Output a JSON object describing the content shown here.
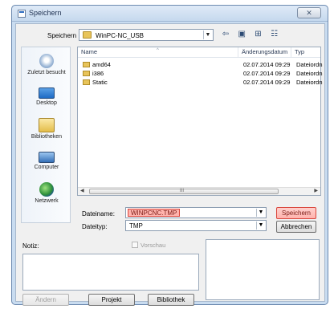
{
  "window": {
    "title": "Speichern",
    "close_label": "✕"
  },
  "top": {
    "save_in_label": "Speichern",
    "path": "WinPC-NC_USB",
    "nav_icons": [
      "back-icon",
      "up-folder-icon",
      "new-folder-icon",
      "view-menu-icon"
    ]
  },
  "places": [
    {
      "label": "Zuletzt besucht",
      "icon": "recent-places-icon"
    },
    {
      "label": "Desktop",
      "icon": "desktop-icon"
    },
    {
      "label": "Bibliotheken",
      "icon": "libraries-icon"
    },
    {
      "label": "Computer",
      "icon": "computer-icon"
    },
    {
      "label": "Netzwerk",
      "icon": "network-icon"
    }
  ],
  "filelist": {
    "columns": [
      "Name",
      "Änderungsdatum",
      "Typ"
    ],
    "rows": [
      {
        "name": "amd64",
        "date": "02.07.2014 09:29",
        "type": "Dateiordn"
      },
      {
        "name": "i386",
        "date": "02.07.2014 09:29",
        "type": "Dateiordn"
      },
      {
        "name": "Static",
        "date": "02.07.2014 09:29",
        "type": "Dateiordn"
      }
    ],
    "scroll_grip": "III"
  },
  "form": {
    "filename_label": "Dateiname:",
    "filename_value": "WINPCNC.TMP",
    "filetype_label": "Dateityp:",
    "filetype_value": "TMP",
    "save_button": "Speichern",
    "cancel_button": "Abbrechen"
  },
  "notes": {
    "note_label": "Notiz:",
    "preview_label": "Vorschau"
  },
  "bottom_buttons": {
    "change": "Ändern",
    "project": "Projekt",
    "library": "Bibliothek"
  },
  "colors": {
    "highlight_fill": "#ffb3ad",
    "highlight_border": "#d9463c"
  }
}
